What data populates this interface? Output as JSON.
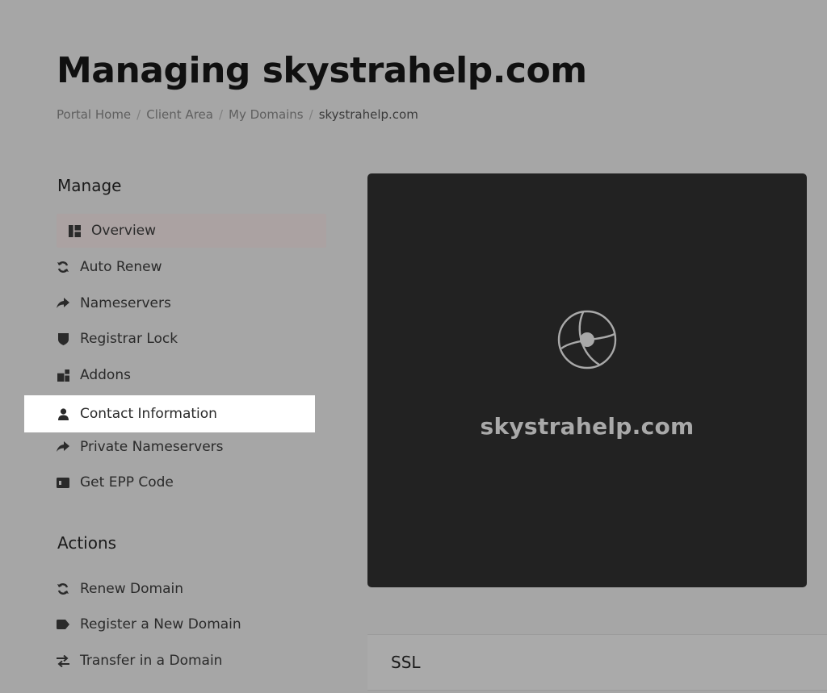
{
  "header": {
    "title": "Managing skystrahelp.com"
  },
  "breadcrumb": {
    "items": [
      "Portal Home",
      "Client Area",
      "My Domains"
    ],
    "current": "skystrahelp.com",
    "separator": "/"
  },
  "manage": {
    "title": "Manage",
    "items": [
      {
        "label": "Overview",
        "icon": "dashboard-icon"
      },
      {
        "label": "Auto Renew",
        "icon": "sync-icon"
      },
      {
        "label": "Nameservers",
        "icon": "share-arrow-icon"
      },
      {
        "label": "Registrar Lock",
        "icon": "shield-icon"
      },
      {
        "label": "Addons",
        "icon": "cubes-icon"
      },
      {
        "label": "Contact Information",
        "icon": "user-icon"
      },
      {
        "label": "Private Nameservers",
        "icon": "share-arrow-icon"
      },
      {
        "label": "Get EPP Code",
        "icon": "id-card-icon"
      }
    ]
  },
  "actions": {
    "title": "Actions",
    "items": [
      {
        "label": "Renew Domain",
        "icon": "sync-icon"
      },
      {
        "label": "Register a New Domain",
        "icon": "tag-icon"
      },
      {
        "label": "Transfer in a Domain",
        "icon": "exchange-icon"
      }
    ]
  },
  "domain_card": {
    "domain": "skystrahelp.com",
    "icon": "globe-icon"
  },
  "ssl": {
    "title": "SSL"
  },
  "colors": {
    "background": "#a6a6a6",
    "card": "#222222",
    "active_item": "#aba2a2",
    "highlight": "#ffffff"
  }
}
